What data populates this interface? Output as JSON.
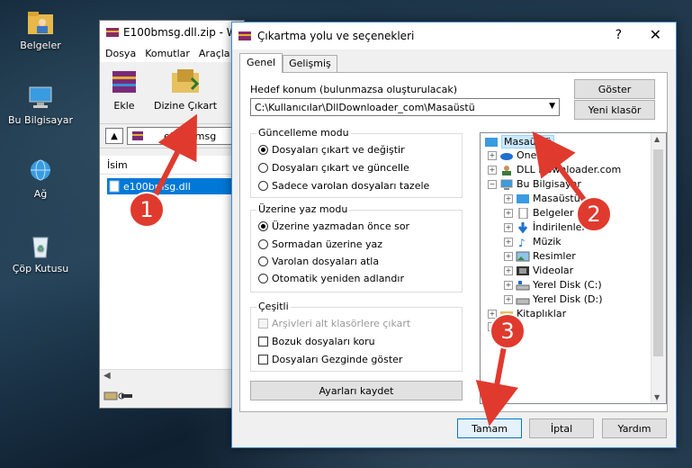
{
  "desktop": {
    "icons": [
      {
        "label": "Belgeler",
        "icon": "folder-user-icon"
      },
      {
        "label": "Bu Bilgisayar",
        "icon": "computer-icon"
      },
      {
        "label": "Ağ",
        "icon": "network-icon"
      },
      {
        "label": "Çöp Kutusu",
        "icon": "recycle-bin-icon"
      }
    ]
  },
  "winrar": {
    "title": "E100bmsg.dll.zip - W",
    "menu": [
      "Dosya",
      "Komutlar",
      "Araçla"
    ],
    "tools": [
      {
        "label": "Ekle"
      },
      {
        "label": "Dizine Çıkart"
      }
    ],
    "path": "e100bmsg",
    "column_name": "İsim",
    "file": "e100bmsg.dll"
  },
  "dialog": {
    "title": "Çıkartma yolu ve seçenekleri",
    "help": "?",
    "tabs": [
      "Genel",
      "Gelişmiş"
    ],
    "dest_label": "Hedef konum (bulunmazsa oluşturulacak)",
    "dest_value": "C:\\Kullanıcılar\\DllDownloader_com\\Masaüstü",
    "show_button": "Göster",
    "new_folder_button": "Yeni klasör",
    "update_group": {
      "title": "Güncelleme modu",
      "options": [
        "Dosyaları çıkart ve değiştir",
        "Dosyaları çıkart ve güncelle",
        "Sadece varolan dosyaları tazele"
      ],
      "selected": 0
    },
    "overwrite_group": {
      "title": "Üzerine yaz modu",
      "options": [
        "Üzerine yazmadan önce sor",
        "Sormadan üzerine yaz",
        "Varolan dosyaları atla",
        "Otomatik yeniden adlandır"
      ],
      "selected": 0
    },
    "misc_group": {
      "title": "Çeşitli",
      "options": [
        "Arşivleri alt klasörlere çıkart",
        "Bozuk dosyaları koru",
        "Dosyaları Gezginde göster"
      ]
    },
    "save_settings": "Ayarları kaydet",
    "tree": [
      {
        "label": "Masaüstü",
        "level": 0,
        "selected": true
      },
      {
        "label": "OneDri",
        "level": 1
      },
      {
        "label": "DLL Downloader.com",
        "level": 1
      },
      {
        "label": "Bu Bilgisayar",
        "level": 1
      },
      {
        "label": "Masaüstü",
        "level": 2
      },
      {
        "label": "Belgeler",
        "level": 2
      },
      {
        "label": "İndirilenler",
        "level": 2
      },
      {
        "label": "Müzik",
        "level": 2
      },
      {
        "label": "Resimler",
        "level": 2
      },
      {
        "label": "Videolar",
        "level": 2
      },
      {
        "label": "Yerel Disk (C:)",
        "level": 2
      },
      {
        "label": "Yerel Disk (D:)",
        "level": 2
      },
      {
        "label": "Kitaplıklar",
        "level": 1
      }
    ],
    "buttons": {
      "ok": "Tamam",
      "cancel": "İptal",
      "help": "Yardım"
    }
  },
  "annotations": {
    "badges": [
      "1",
      "2",
      "3"
    ],
    "color": "#e03a2e"
  }
}
